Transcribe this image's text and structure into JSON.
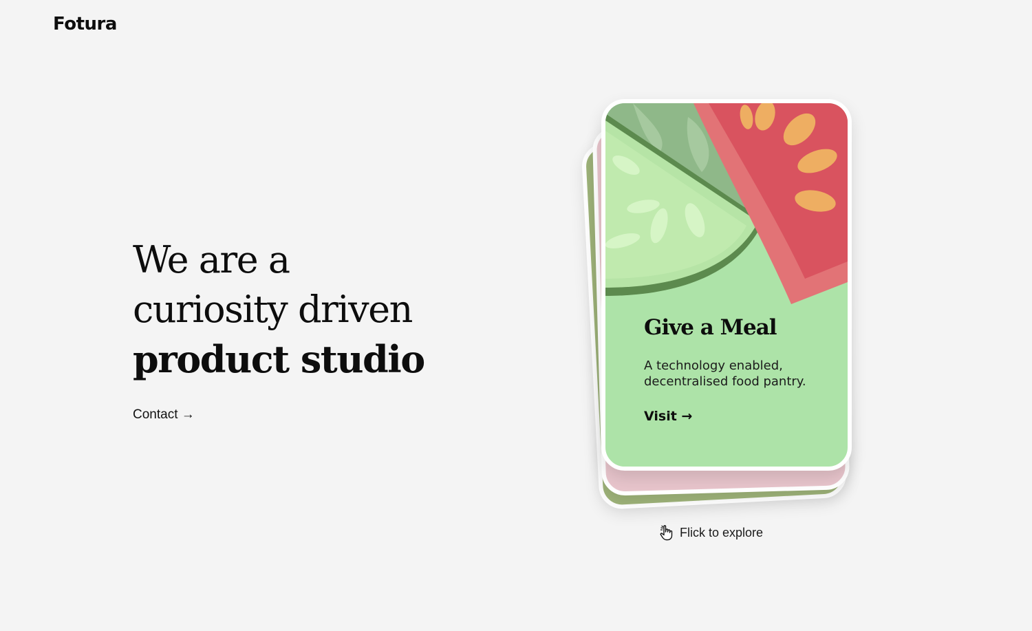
{
  "brand": {
    "name": "Fotura"
  },
  "hero": {
    "line1": "We are a",
    "line2": "curiosity driven",
    "line3": "product studio"
  },
  "contact": {
    "label": "Contact →"
  },
  "card": {
    "title": "Give a Meal",
    "description": "A technology enabled, decentralised food pantry.",
    "visit_label": "Visit →"
  },
  "hint": {
    "label": "Flick to explore",
    "icon": "hand-pointer-icon"
  },
  "colors": {
    "background": "#f4f4f4",
    "card_green": "#ade3a8",
    "tomato_red": "#d9535f",
    "seed_orange": "#eeae62",
    "cucumber_rind": "#5c8a4e",
    "back_card_pink": "#e8c5cc",
    "back_card_olive": "#9fb47a"
  }
}
